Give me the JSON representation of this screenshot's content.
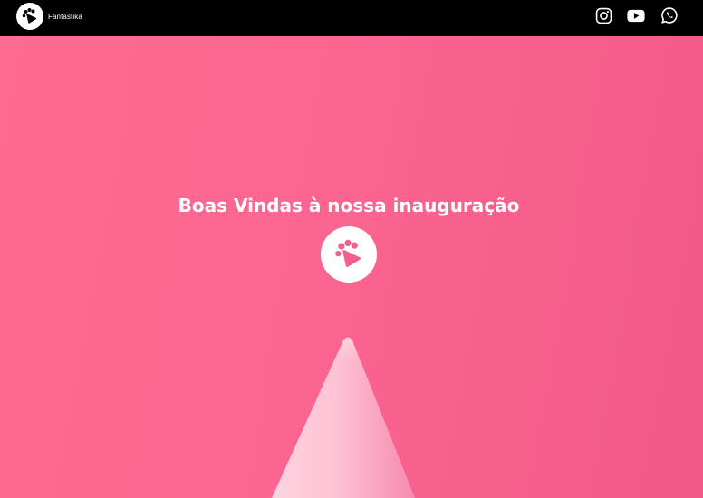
{
  "header": {
    "brand_name": "Fantastika",
    "social": [
      {
        "icon": "instagram-icon"
      },
      {
        "icon": "youtube-icon"
      },
      {
        "icon": "whatsapp-icon"
      }
    ]
  },
  "hero": {
    "headline": "Boas Vindas à nossa inauguração",
    "logo_icon": "paw-play-icon"
  },
  "colors": {
    "topbar": "#000000",
    "hero_pink": "#fb6590",
    "logo_mark": "#f45e8c",
    "text": "#ffffff"
  }
}
